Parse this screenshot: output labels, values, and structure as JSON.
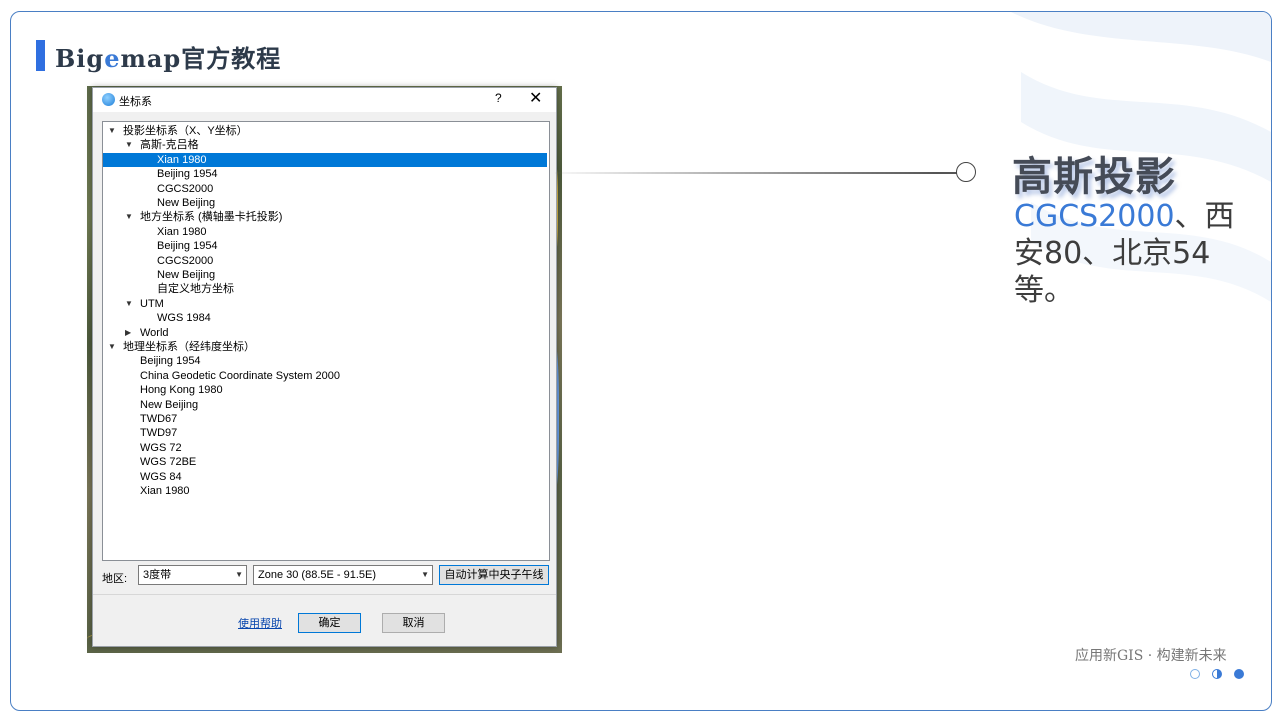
{
  "slide": {
    "title_prefix": "Big",
    "title_accent": "e",
    "title_suffix": "map官方教程",
    "heading": "高斯投影",
    "desc_accent": "CGCS2000",
    "desc_rest": "、西安80、北京54等。",
    "tagline": "应用新GIS · 构建新未来",
    "accent_color": "#3a7ad6"
  },
  "dialog": {
    "title": "坐标系",
    "help_symbol": "?",
    "close_symbol": "✕",
    "tree": [
      {
        "label": "投影坐标系（X、Y坐标）",
        "expander": "expanded",
        "level": 0,
        "selected": false
      },
      {
        "label": "高斯-克吕格",
        "expander": "expanded",
        "level": 1,
        "selected": false
      },
      {
        "label": "Xian 1980",
        "expander": "none",
        "level": 2,
        "selected": true
      },
      {
        "label": "Beijing 1954",
        "expander": "none",
        "level": 2,
        "selected": false
      },
      {
        "label": "CGCS2000",
        "expander": "none",
        "level": 2,
        "selected": false
      },
      {
        "label": "New Beijing",
        "expander": "none",
        "level": 2,
        "selected": false
      },
      {
        "label": "地方坐标系 (横轴墨卡托投影)",
        "expander": "expanded",
        "level": 1,
        "selected": false
      },
      {
        "label": "Xian 1980",
        "expander": "none",
        "level": 2,
        "selected": false
      },
      {
        "label": "Beijing 1954",
        "expander": "none",
        "level": 2,
        "selected": false
      },
      {
        "label": "CGCS2000",
        "expander": "none",
        "level": 2,
        "selected": false
      },
      {
        "label": "New Beijing",
        "expander": "none",
        "level": 2,
        "selected": false
      },
      {
        "label": "自定义地方坐标",
        "expander": "none",
        "level": 2,
        "selected": false
      },
      {
        "label": "UTM",
        "expander": "expanded",
        "level": 1,
        "selected": false
      },
      {
        "label": "WGS 1984",
        "expander": "none",
        "level": 2,
        "selected": false
      },
      {
        "label": "World",
        "expander": "collapsed",
        "level": 1,
        "selected": false
      },
      {
        "label": "地理坐标系（经纬度坐标）",
        "expander": "expanded",
        "level": 0,
        "selected": false
      },
      {
        "label": "Beijing 1954",
        "expander": "none",
        "level": 1,
        "selected": false
      },
      {
        "label": "China Geodetic Coordinate System 2000",
        "expander": "none",
        "level": 1,
        "selected": false
      },
      {
        "label": "Hong Kong 1980",
        "expander": "none",
        "level": 1,
        "selected": false
      },
      {
        "label": "New Beijing",
        "expander": "none",
        "level": 1,
        "selected": false
      },
      {
        "label": "TWD67",
        "expander": "none",
        "level": 1,
        "selected": false
      },
      {
        "label": "TWD97",
        "expander": "none",
        "level": 1,
        "selected": false
      },
      {
        "label": "WGS 72",
        "expander": "none",
        "level": 1,
        "selected": false
      },
      {
        "label": "WGS 72BE",
        "expander": "none",
        "level": 1,
        "selected": false
      },
      {
        "label": "WGS 84",
        "expander": "none",
        "level": 1,
        "selected": false
      },
      {
        "label": "Xian 1980",
        "expander": "none",
        "level": 1,
        "selected": false
      }
    ],
    "area_label": "地区:",
    "zone_type_value": "3度带",
    "zone_value": "Zone 30 (88.5E - 91.5E)",
    "auto_calc_label": "自动计算中央子午线",
    "help_link": "使用帮助",
    "ok_label": "确定",
    "cancel_label": "取消"
  },
  "colors": {
    "selection": "#0078d7",
    "frame_border": "#4a7fc4",
    "title_bar_accent": "#2f6fe0"
  },
  "icons": [
    "app-logo-icon",
    "expand-arrow-icon",
    "collapse-arrow-icon",
    "dropdown-arrow-icon",
    "close-icon"
  ]
}
